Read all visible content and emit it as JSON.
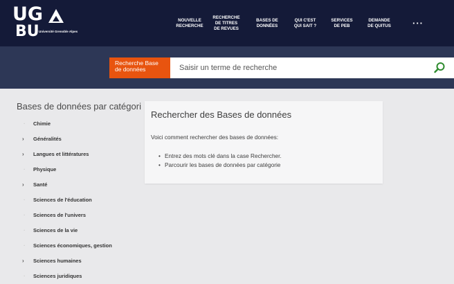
{
  "logo": {
    "line1": "UG",
    "line2": "BU",
    "subtitle": "Université Grenoble Alpes"
  },
  "nav": [
    {
      "label": "NOUVELLE\nRECHERCHE"
    },
    {
      "label": "RECHERCHE\nDE TITRES\nDE REVUES"
    },
    {
      "label": "BASES DE\nDONNÉES"
    },
    {
      "label": "QUI C'EST\nQUI SAIT ?"
    },
    {
      "label": "SERVICES\nDE PEB"
    },
    {
      "label": "DEMANDE\nDE QUITUS"
    }
  ],
  "more_label": "···",
  "search": {
    "category_label": "Recherche Base de données",
    "placeholder": "Saisir un terme de recherche"
  },
  "sidebar": {
    "title": "Bases de données par catégori",
    "items": [
      {
        "label": "Chimie",
        "expandable": false
      },
      {
        "label": "Généralités",
        "expandable": true
      },
      {
        "label": "Langues et littératures",
        "expandable": true
      },
      {
        "label": "Physique",
        "expandable": false
      },
      {
        "label": "Santé",
        "expandable": true
      },
      {
        "label": "Sciences de l'éducation",
        "expandable": false
      },
      {
        "label": "Sciences de l'univers",
        "expandable": false
      },
      {
        "label": "Sciences de la vie",
        "expandable": false
      },
      {
        "label": "Sciences économiques, gestion",
        "expandable": false
      },
      {
        "label": "Sciences humaines",
        "expandable": true
      },
      {
        "label": "Sciences juridiques",
        "expandable": false
      }
    ]
  },
  "main": {
    "title": "Rechercher des Bases de données",
    "intro": "Voici comment rechercher des bases de données:",
    "bullets": [
      "Entrez des mots clé dans la case Rechercher.",
      "Parcourir les bases de données par catégorie"
    ]
  },
  "colors": {
    "topbar": "#141a38",
    "searchband": "#2d3756",
    "accent": "#e8540f",
    "search_icon": "#2e8b2e",
    "background": "#e9e9eb"
  },
  "icons": {
    "search": "search-icon",
    "arrow": "chevron-right-icon"
  }
}
